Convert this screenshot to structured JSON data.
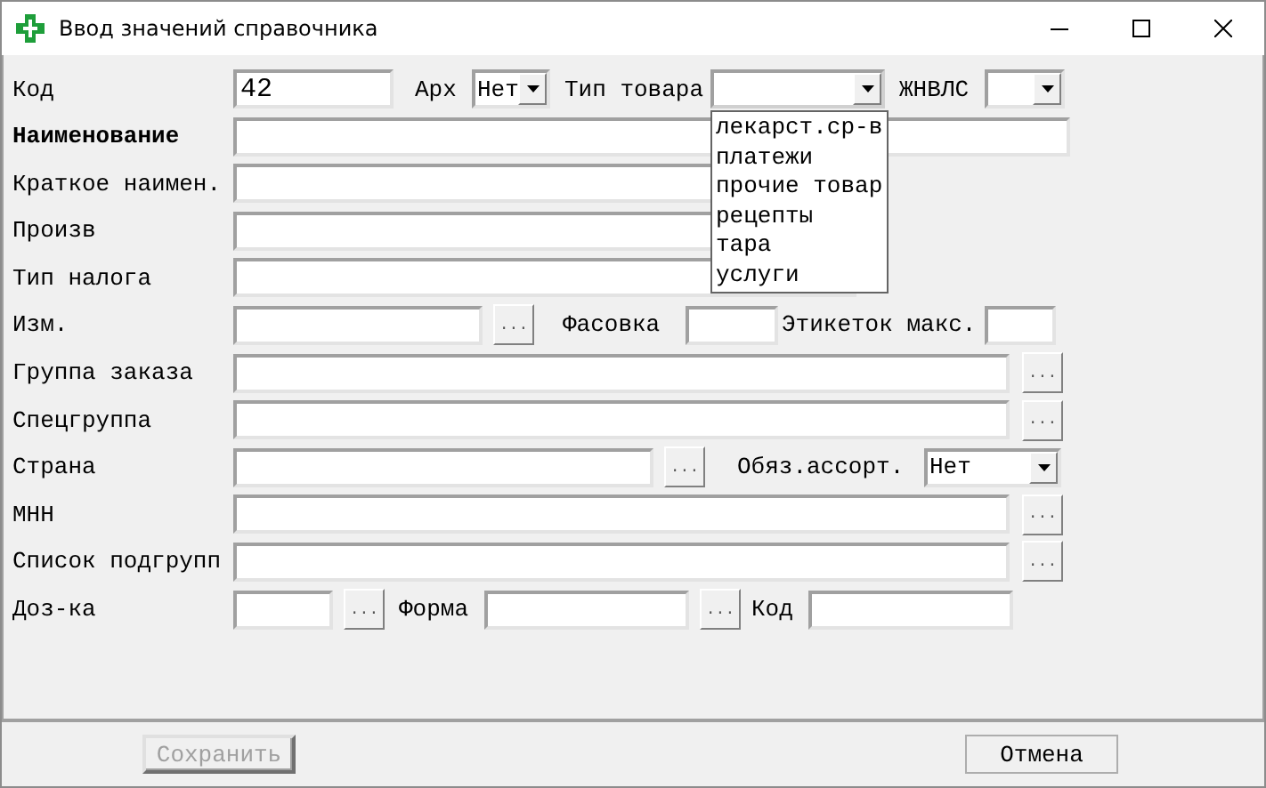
{
  "window": {
    "title": "Ввод значений справочника"
  },
  "rows": [
    {
      "items": [
        {
          "kind": "label",
          "text": "Код"
        },
        {
          "kind": "field",
          "value": "42"
        },
        {
          "kind": "label",
          "text": "Арх"
        },
        {
          "kind": "combo",
          "value": "Нет",
          "expanded": false
        },
        {
          "kind": "label",
          "text": "Тип товара"
        },
        {
          "kind": "combo",
          "expanded": true,
          "options": [
            "лекарст.ср-в",
            "платежи",
            "прочие товар",
            "рецепты",
            "тара",
            "услуги"
          ]
        },
        {
          "kind": "label",
          "text": "ЖНВЛС"
        },
        {
          "kind": "combo",
          "expanded": false
        }
      ]
    },
    {
      "items": [
        {
          "kind": "label_strong",
          "text": "Наименование"
        },
        {
          "kind": "field"
        }
      ]
    },
    {
      "items": [
        {
          "kind": "label",
          "text": "Краткое наимен."
        },
        {
          "kind": "field"
        }
      ]
    },
    {
      "items": [
        {
          "kind": "label",
          "text": "Произв"
        },
        {
          "kind": "field"
        }
      ]
    },
    {
      "items": [
        {
          "kind": "label",
          "text": "Тип налога"
        },
        {
          "kind": "field"
        }
      ]
    },
    {
      "items": [
        {
          "kind": "label",
          "text": "Изм."
        },
        {
          "kind": "field"
        },
        {
          "kind": "button",
          "text": "..."
        },
        {
          "kind": "label",
          "text": "Фасовка"
        },
        {
          "kind": "field"
        },
        {
          "kind": "label",
          "text": "Этикеток макс."
        },
        {
          "kind": "field"
        }
      ]
    },
    {
      "items": [
        {
          "kind": "label",
          "text": "Группа заказа"
        },
        {
          "kind": "field"
        },
        {
          "kind": "button",
          "text": "..."
        }
      ]
    },
    {
      "items": [
        {
          "kind": "label",
          "text": "Спецгруппа"
        },
        {
          "kind": "field"
        },
        {
          "kind": "button",
          "text": "..."
        }
      ]
    },
    {
      "items": [
        {
          "kind": "label",
          "text": "Страна"
        },
        {
          "kind": "field"
        },
        {
          "kind": "button",
          "text": "..."
        },
        {
          "kind": "label",
          "text": "Обяз.ассорт."
        },
        {
          "kind": "combo",
          "value": "Нет",
          "expanded": false
        }
      ]
    },
    {
      "items": [
        {
          "kind": "label",
          "text": "МНН"
        },
        {
          "kind": "field"
        },
        {
          "kind": "button",
          "text": "..."
        }
      ]
    },
    {
      "items": [
        {
          "kind": "label",
          "text": "Список подгрупп"
        },
        {
          "kind": "field"
        },
        {
          "kind": "button",
          "text": "..."
        }
      ]
    },
    {
      "items": [
        {
          "kind": "label",
          "text": "Доз-ка"
        },
        {
          "kind": "field"
        },
        {
          "kind": "button",
          "text": "..."
        },
        {
          "kind": "label",
          "text": "Форма"
        },
        {
          "kind": "field"
        },
        {
          "kind": "button",
          "text": "..."
        },
        {
          "kind": "label",
          "text": "Код"
        },
        {
          "kind": "field"
        }
      ]
    }
  ],
  "buttons": [
    {
      "label": "Сохранить",
      "disabled": true
    },
    {
      "label": "Отмена",
      "disabled": false
    }
  ]
}
